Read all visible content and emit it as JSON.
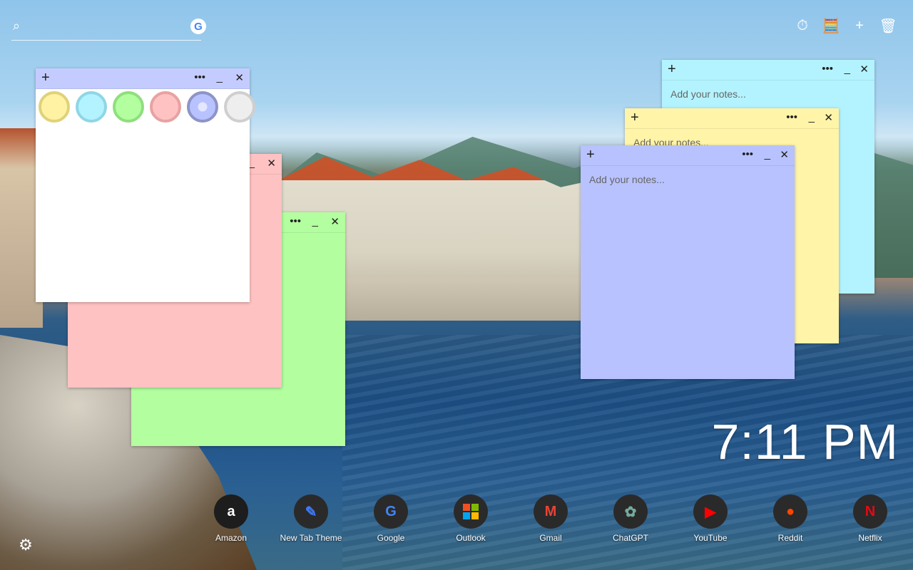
{
  "search": {
    "placeholder": "",
    "google_label": "G"
  },
  "toolbar": {
    "items": [
      {
        "icon": "stopwatch-icon",
        "glyph": "⏱"
      },
      {
        "icon": "calculator-icon",
        "glyph": "🧮"
      },
      {
        "icon": "new-note-icon",
        "glyph": "+"
      },
      {
        "icon": "trash-icon",
        "glyph": "🗑"
      }
    ]
  },
  "notes": [
    {
      "id": "cyan",
      "color": "#b3f3ff",
      "placeholder": "Add your notes..."
    },
    {
      "id": "yellow",
      "color": "#fff4a8",
      "placeholder": "Add your notes..."
    },
    {
      "id": "blue",
      "color": "#b8c2ff",
      "placeholder": "Add your notes..."
    },
    {
      "id": "green",
      "color": "#b3ff9f",
      "placeholder": ""
    },
    {
      "id": "pink",
      "color": "#ffc2c2",
      "placeholder": ""
    },
    {
      "id": "white",
      "color": "#ffffff",
      "header_color": "#c4ccff",
      "placeholder": ""
    }
  ],
  "note_controls": {
    "add": "+",
    "more": "•••",
    "minimize": "_",
    "close": "✕"
  },
  "palette": [
    {
      "name": "yellow",
      "fill": "#fff3a3",
      "ring": "#e0d27a"
    },
    {
      "name": "cyan",
      "fill": "#b3f3ff",
      "ring": "#8fd6e6"
    },
    {
      "name": "green",
      "fill": "#b3ff9f",
      "ring": "#8fdf7d"
    },
    {
      "name": "pink",
      "fill": "#ffc2c2",
      "ring": "#e7a2a2"
    },
    {
      "name": "blue",
      "fill": "#b8c2ff",
      "ring": "#8c94c8",
      "selected": true
    },
    {
      "name": "gray",
      "fill": "#eeeeee",
      "ring": "#cfcfcf"
    }
  ],
  "clock": "7:11 PM",
  "shortcuts": [
    {
      "label": "Amazon",
      "glyph": "a",
      "color": "#ffffff"
    },
    {
      "label": "New Tab Theme",
      "glyph": "✎",
      "color": "#3b7bff"
    },
    {
      "label": "Google",
      "glyph": "G",
      "color": "#4285f4"
    },
    {
      "label": "Outlook",
      "glyph": "■",
      "color": "#f25022"
    },
    {
      "label": "Gmail",
      "glyph": "M",
      "color": "#ea4335"
    },
    {
      "label": "ChatGPT",
      "glyph": "✿",
      "color": "#74aa9c"
    },
    {
      "label": "YouTube",
      "glyph": "▶",
      "color": "#ff0000"
    },
    {
      "label": "Reddit",
      "glyph": "●",
      "color": "#ff4500"
    },
    {
      "label": "Netflix",
      "glyph": "N",
      "color": "#e50914"
    }
  ],
  "settings_icon": "gear-icon"
}
